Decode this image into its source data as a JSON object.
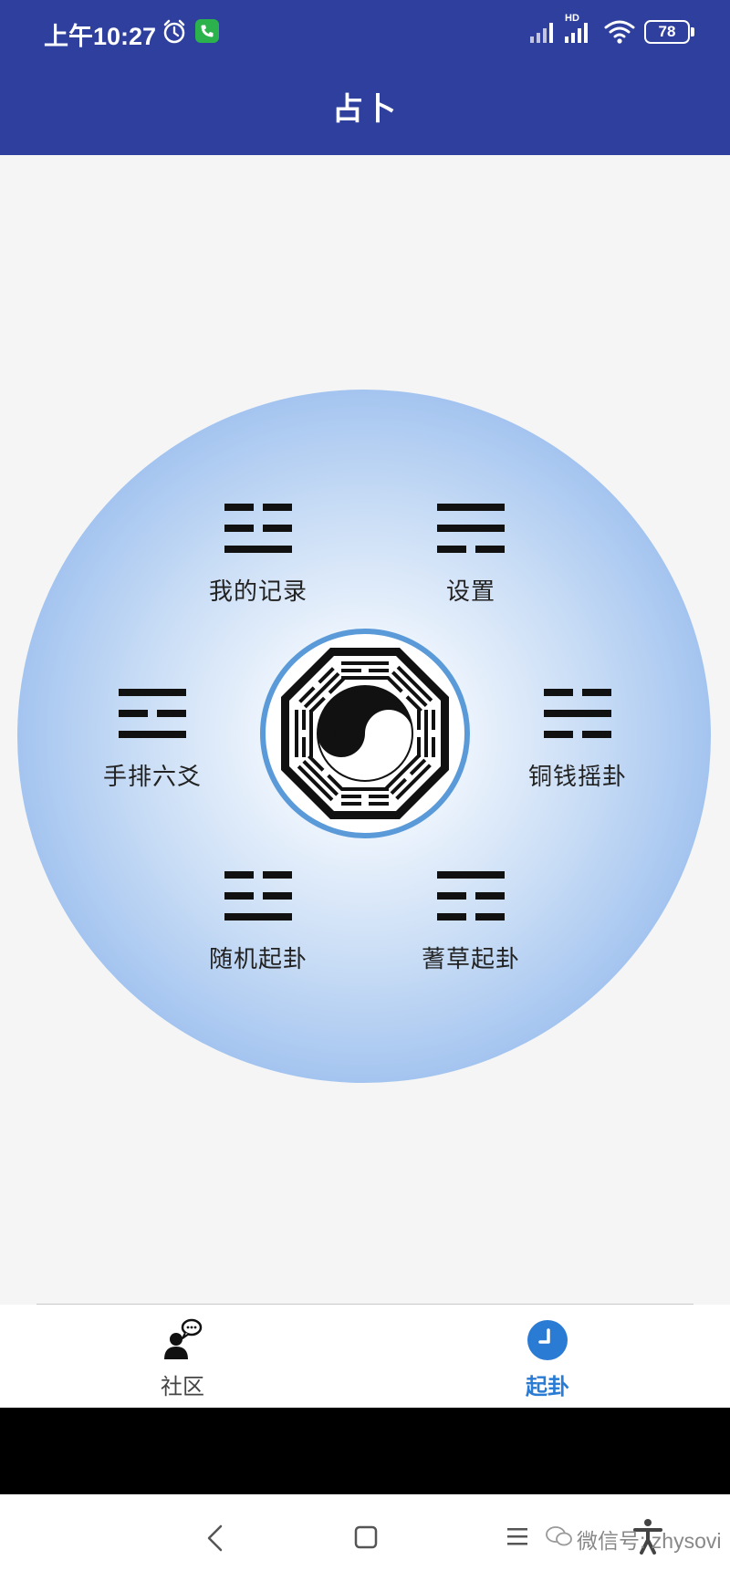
{
  "status_bar": {
    "time": "上午10:27",
    "network_badge": "HD",
    "battery": "78",
    "icons": [
      "alarm-icon",
      "phone-icon",
      "signal-icon",
      "signal-hd-icon",
      "wifi-icon",
      "battery-icon"
    ],
    "phone_icon_color": "#2bb24c"
  },
  "header": {
    "title": "占卜",
    "background_color": "#2f3f9e"
  },
  "menu": {
    "items": [
      {
        "label": "我的记录",
        "icon": "trigram-kun-icon"
      },
      {
        "label": "设置",
        "icon": "trigram-xun-icon"
      },
      {
        "label": "手排六爻",
        "icon": "trigram-kan-icon"
      },
      {
        "label": "铜钱摇卦",
        "icon": "trigram-zhen-icon"
      },
      {
        "label": "随机起卦",
        "icon": "trigram-dui-icon"
      },
      {
        "label": "蓍草起卦",
        "icon": "trigram-gen-icon"
      }
    ],
    "center_icon": "bagua-yin-yang-icon",
    "disc_colors": [
      "#ffffff",
      "#87aeea"
    ],
    "ring_color": "#5a9ad8"
  },
  "tabbar": {
    "tabs": [
      {
        "label": "社区",
        "icon": "community-chat-icon",
        "active": false
      },
      {
        "label": "起卦",
        "icon": "clock-icon",
        "active": true
      }
    ],
    "active_color": "#2a7bd4"
  },
  "nav_bar": {
    "buttons": [
      "back-icon",
      "home-icon",
      "recents-icon",
      "accessibility-icon"
    ],
    "watermark": "微信号: zhysovi"
  }
}
